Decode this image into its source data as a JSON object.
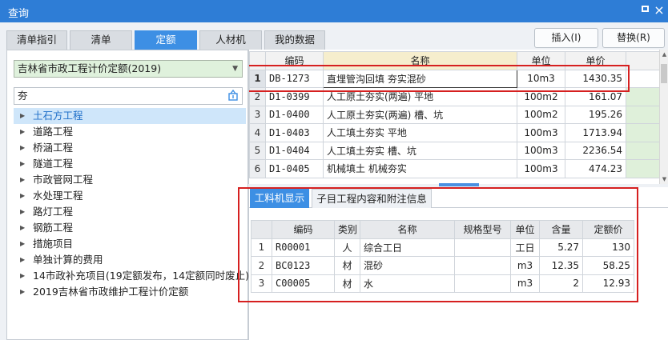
{
  "window": {
    "title": "查询",
    "max_glyph": "",
    "close_glyph": "×"
  },
  "tabs": [
    "清单指引",
    "清单",
    "定额",
    "人材机",
    "我的数据"
  ],
  "buttons": {
    "insert": "插入(I)",
    "replace": "替换(R)"
  },
  "left": {
    "select_value": "吉林省市政工程计价定额(2019)",
    "search_value": "夯",
    "tree": [
      "土石方工程",
      "道路工程",
      "桥涵工程",
      "隧道工程",
      "市政管网工程",
      "水处理工程",
      "路灯工程",
      "钢筋工程",
      "措施项目",
      "单独计算的费用",
      "14市政补充项目(19定额发布，14定额同时废止)",
      "2019吉林省市政维护工程计价定额"
    ]
  },
  "upper_table": {
    "headers": [
      "编码",
      "名称",
      "单位",
      "单价"
    ],
    "rows": [
      {
        "num": "1",
        "code": "DB-1273",
        "name": "直埋管沟回填 夯实混砂",
        "unit": "10m3",
        "price": "1430.35"
      },
      {
        "num": "2",
        "code": "D1-0399",
        "name": "人工原土夯实(两遍) 平地",
        "unit": "100m2",
        "price": "161.07"
      },
      {
        "num": "3",
        "code": "D1-0400",
        "name": "人工原土夯实(两遍) 槽、坑",
        "unit": "100m2",
        "price": "195.26"
      },
      {
        "num": "4",
        "code": "D1-0403",
        "name": "人工填土夯实 平地",
        "unit": "100m3",
        "price": "1713.94"
      },
      {
        "num": "5",
        "code": "D1-0404",
        "name": "人工填土夯实 槽、坑",
        "unit": "100m3",
        "price": "2236.54"
      },
      {
        "num": "6",
        "code": "D1-0405",
        "name": "机械填土 机械夯实",
        "unit": "100m3",
        "price": "474.23"
      }
    ]
  },
  "subtabs": [
    "工料机显示",
    "子目工程内容和附注信息"
  ],
  "lower_table": {
    "headers": [
      "编码",
      "类别",
      "名称",
      "规格型号",
      "单位",
      "含量",
      "定额价"
    ],
    "rows": [
      {
        "num": "1",
        "code": "R00001",
        "type": "人",
        "name": "综合工日",
        "spec": "",
        "unit": "工日",
        "qty": "5.27",
        "price": "130"
      },
      {
        "num": "2",
        "code": "BC0123",
        "type": "材",
        "name": "混砂",
        "spec": "",
        "unit": "m3",
        "qty": "12.35",
        "price": "58.25"
      },
      {
        "num": "3",
        "code": "C00005",
        "type": "材",
        "name": "水",
        "spec": "",
        "unit": "m3",
        "qty": "2",
        "price": "12.93"
      }
    ]
  },
  "colors": {
    "titlebar": "#2e7dd6",
    "accent": "#3d8fe4",
    "highlight_box": "#d62020",
    "green_cell": "#dff0da"
  }
}
